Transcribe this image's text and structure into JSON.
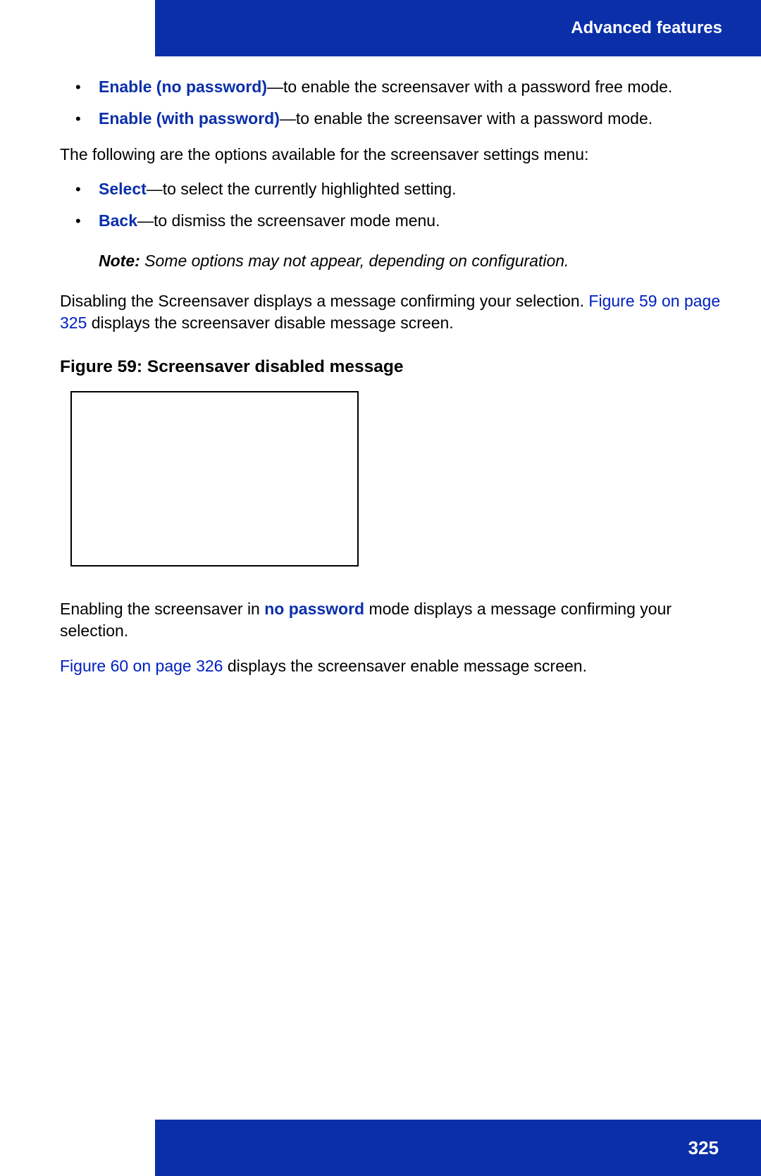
{
  "header": {
    "title": "Advanced features"
  },
  "bullets1": {
    "item0": {
      "term": "Enable (no password)",
      "rest": "—to enable the screensaver with a password free mode."
    },
    "item1": {
      "term": "Enable (with password)",
      "rest": "—to enable the screensaver with a password mode."
    }
  },
  "para_options": "The following are the options available for the screensaver settings menu:",
  "bullets2": {
    "item0": {
      "term": "Select",
      "rest": "—to select the currently highlighted setting."
    },
    "item1": {
      "term": "Back",
      "rest": "—to dismiss the screensaver mode menu."
    }
  },
  "note": {
    "label": "Note:",
    "text": "  Some options may not appear, depending on configuration."
  },
  "para_disable": {
    "pre": "Disabling the Screensaver displays a message confirming your selection. ",
    "link": "Figure 59 on page 325",
    "post": " displays the screensaver disable message screen."
  },
  "figure": {
    "title": "Figure 59: Screensaver disabled message"
  },
  "para_enable": {
    "pre": "Enabling the screensaver in ",
    "term": "no password",
    "post": " mode displays a message confirming your selection."
  },
  "para_fig60": {
    "link": "Figure 60 on page 326",
    "post": " displays the screensaver enable message screen."
  },
  "footer": {
    "page": "325"
  }
}
